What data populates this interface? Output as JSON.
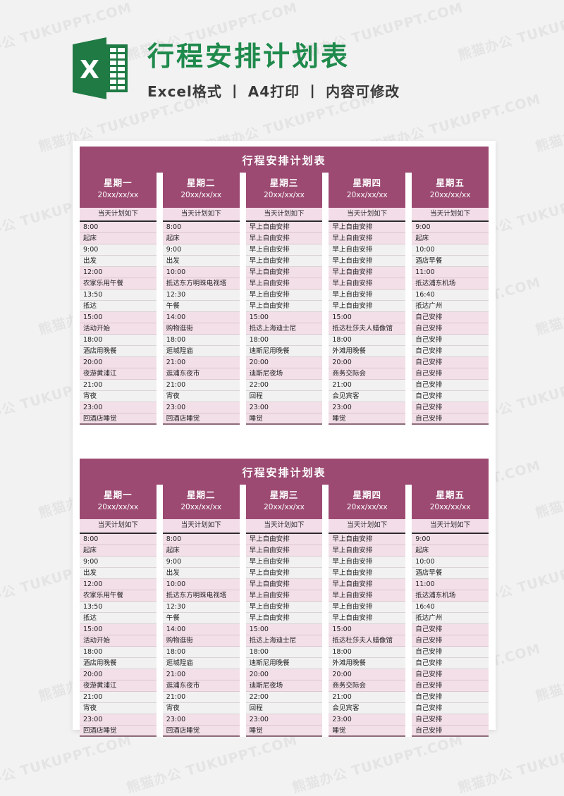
{
  "banner": {
    "logo_name": "excel-logo",
    "title": "行程安排计划表",
    "subtitle": "Excel格式 丨 A4打印 丨 内容可修改",
    "title_color": "#1f8a4c"
  },
  "watermark": {
    "text": "熊猫办公 TUKUPPT.COM"
  },
  "theme": {
    "header_purple": "#9c4a72",
    "row_pink": "#f3dfe8",
    "row_grey": "#f1f1f1",
    "subhead_pink": "#f3dde8",
    "page_bg": "#f2f2f2"
  },
  "sheet": {
    "title": "行程安排计划表",
    "subhead": "当天计划如下",
    "columns": [
      {
        "dow": "星期一",
        "date": "20xx/xx/xx",
        "cells": [
          "8:00",
          "起床",
          "9:00",
          "出发",
          "12:00",
          "农家乐用午餐",
          "13:50",
          "抵达",
          "15:00",
          "活动开始",
          "18:00",
          "酒店用晚餐",
          "20:00",
          "夜游黄浦江",
          "21:00",
          "宵夜",
          "23:00",
          "回酒店睡觉"
        ]
      },
      {
        "dow": "星期二",
        "date": "20xx/xx/xx",
        "cells": [
          "8:00",
          "起床",
          "9:00",
          "出发",
          "10:00",
          "抵达东方明珠电视塔",
          "12:30",
          "午餐",
          "14:00",
          "购物逛街",
          "18:00",
          "逛城隍庙",
          "21:00",
          "逛浦东夜市",
          "21:00",
          "宵夜",
          "23:00",
          "回酒店睡觉"
        ]
      },
      {
        "dow": "星期三",
        "date": "20xx/xx/xx",
        "cells": [
          "早上自由安排",
          "早上自由安排",
          "早上自由安排",
          "早上自由安排",
          "早上自由安排",
          "早上自由安排",
          "早上自由安排",
          "早上自由安排",
          "15:00",
          "抵达上海迪士尼",
          "18:00",
          "迪斯尼用晚餐",
          "20:00",
          "迪斯尼夜场",
          "22:00",
          "回程",
          "23:00",
          "睡觉"
        ]
      },
      {
        "dow": "星期四",
        "date": "20xx/xx/xx",
        "cells": [
          "早上自由安排",
          "早上自由安排",
          "早上自由安排",
          "早上自由安排",
          "早上自由安排",
          "早上自由安排",
          "早上自由安排",
          "早上自由安排",
          "15:00",
          "抵达杜莎夫人蜡像馆",
          "18:00",
          "外滩用晚餐",
          "20:00",
          "商务交际会",
          "21:00",
          "会见宾客",
          "23:00",
          "睡觉"
        ]
      },
      {
        "dow": "星期五",
        "date": "20xx/xx/xx",
        "cells": [
          "9:00",
          "起床",
          "10:00",
          "酒店早餐",
          "11:00",
          "抵达浦东机场",
          "16:40",
          "抵达广州",
          "自己安排",
          "自己安排",
          "自己安排",
          "自己安排",
          "自己安排",
          "自己安排",
          "自己安排",
          "自己安排",
          "自己安排",
          "自己安排"
        ]
      }
    ]
  },
  "sheet_count": 2
}
